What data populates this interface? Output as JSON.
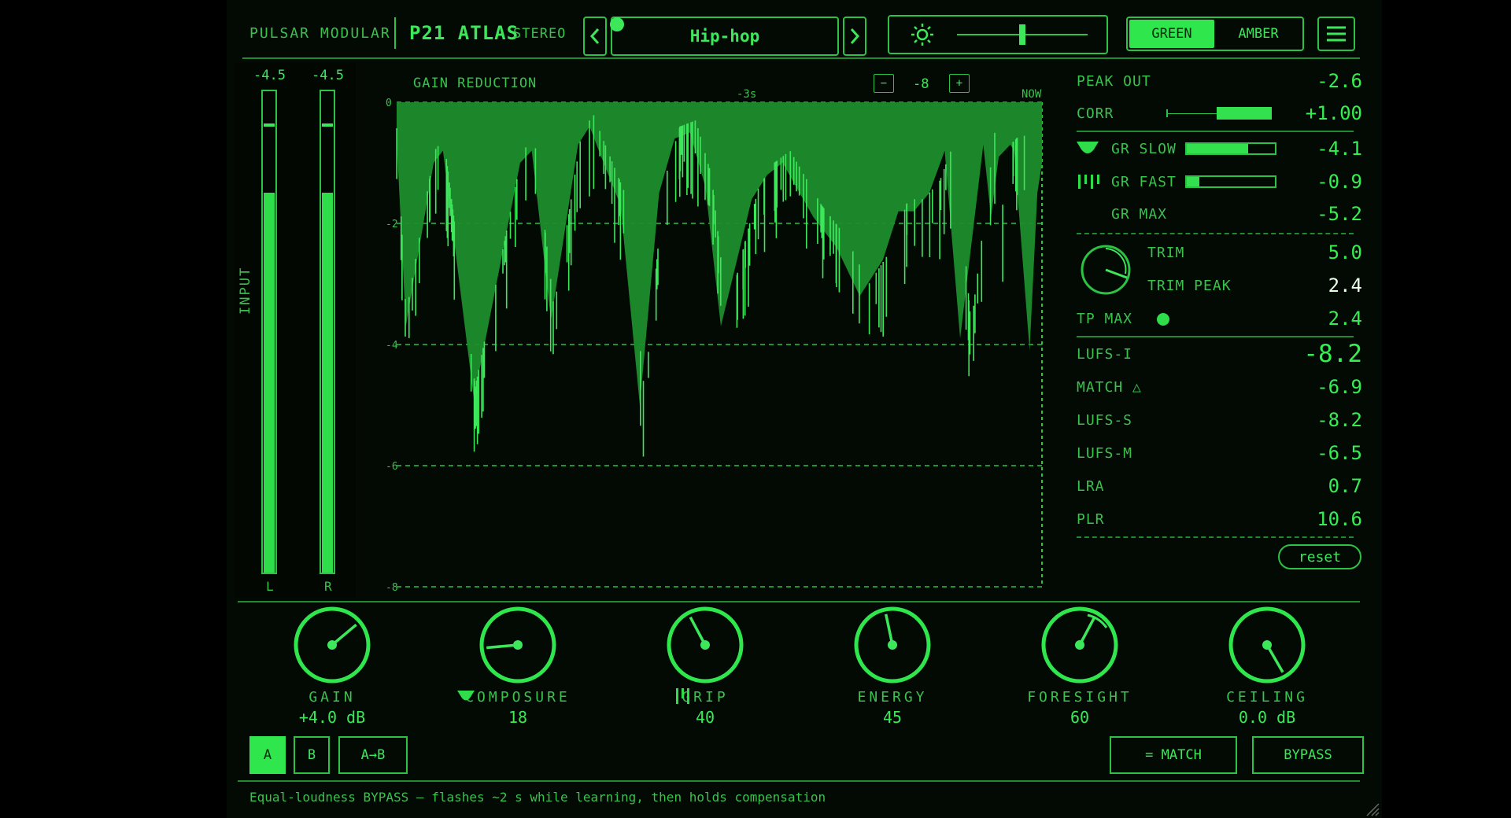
{
  "header": {
    "brand": "PULSAR MODULAR",
    "product": "P21 ATLAS",
    "mode": "STEREO",
    "preset": "Hip-hop",
    "prev_icon": "chevron-left-icon",
    "next_icon": "chevron-right-icon",
    "brightness_icon": "sun-icon",
    "brightness_level": 0.5,
    "theme_green": "GREEN",
    "theme_amber": "AMBER",
    "theme_active": "GREEN",
    "menu_icon": "hamburger-menu-icon"
  },
  "input_meter": {
    "title": "INPUT",
    "left": {
      "label": "L",
      "peak": "-4.5",
      "level": 0.79
    },
    "right": {
      "label": "R",
      "peak": "-4.5",
      "level": 0.79
    }
  },
  "graph": {
    "title": "GAIN REDUCTION",
    "zoom_minus": "−",
    "zoom_value": "-8",
    "zoom_plus": "+",
    "time_mid": "-3s",
    "time_now": "NOW",
    "y_ticks": [
      "0",
      "-2",
      "-4",
      "-6",
      "-8"
    ],
    "ylim": [
      -8,
      0
    ]
  },
  "stats": {
    "peak_out_label": "PEAK OUT",
    "peak_out": "-2.6",
    "corr_label": "CORR",
    "corr": "+1.00",
    "corr_level": 1.0,
    "gr_slow_label": "GR SLOW",
    "gr_slow": "-4.1",
    "gr_slow_level": 0.7,
    "gr_fast_label": "GR FAST",
    "gr_fast": "-0.9",
    "gr_fast_level": 0.14,
    "gr_max_label": "GR MAX",
    "gr_max": "-5.2",
    "trim_label": "TRIM",
    "trim": "5.0",
    "trim_peak_label": "TRIM PEAK",
    "trim_peak": "2.4",
    "tp_max_label": "TP MAX",
    "tp_max": "2.4",
    "lufs_i_label": "LUFS-I",
    "lufs_i": "-8.2",
    "match_label": "MATCH △",
    "match": "-6.9",
    "lufs_s_label": "LUFS-S",
    "lufs_s": "-8.2",
    "lufs_m_label": "LUFS-M",
    "lufs_m": "-6.5",
    "lra_label": "LRA",
    "lra": "0.7",
    "plr_label": "PLR",
    "plr": "10.6",
    "reset": "reset"
  },
  "knobs": [
    {
      "name": "GAIN",
      "value": "+4.0 dB",
      "icon": ""
    },
    {
      "name": "COMPOSURE",
      "value": "18",
      "icon": "slow-shield-icon"
    },
    {
      "name": "GRIP",
      "value": "40",
      "icon": "fast-bars-icon"
    },
    {
      "name": "ENERGY",
      "value": "45",
      "icon": ""
    },
    {
      "name": "FORESIGHT",
      "value": "60",
      "icon": ""
    },
    {
      "name": "CEILING",
      "value": "0.0 dB",
      "icon": ""
    }
  ],
  "footer": {
    "a": "A",
    "b": "B",
    "ab": "A→B",
    "match_btn": "= MATCH",
    "bypass_btn": "BYPASS",
    "status": "Equal-loudness BYPASS — flashes ~2 s while learning, then holds compensation"
  },
  "colors": {
    "accent": "#2fe64c",
    "dim": "#1f8a2e",
    "bg": "#030a03"
  }
}
